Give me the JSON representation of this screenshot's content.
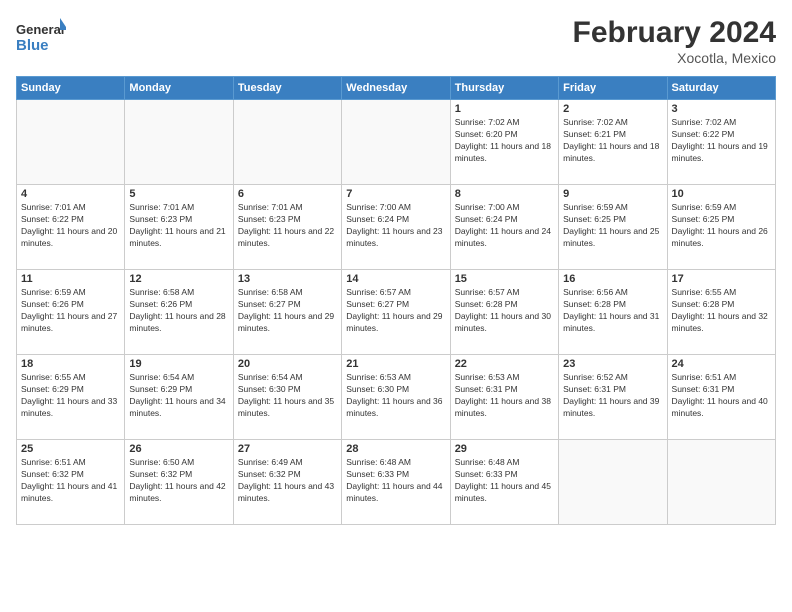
{
  "header": {
    "logo_general": "General",
    "logo_blue": "Blue",
    "main_title": "February 2024",
    "sub_title": "Xocotla, Mexico"
  },
  "weekdays": [
    "Sunday",
    "Monday",
    "Tuesday",
    "Wednesday",
    "Thursday",
    "Friday",
    "Saturday"
  ],
  "days": [
    {
      "num": "",
      "empty": true
    },
    {
      "num": "",
      "empty": true
    },
    {
      "num": "",
      "empty": true
    },
    {
      "num": "",
      "empty": true
    },
    {
      "num": "1",
      "sunrise": "7:02 AM",
      "sunset": "6:20 PM",
      "daylight": "11 hours and 18 minutes."
    },
    {
      "num": "2",
      "sunrise": "7:02 AM",
      "sunset": "6:21 PM",
      "daylight": "11 hours and 18 minutes."
    },
    {
      "num": "3",
      "sunrise": "7:02 AM",
      "sunset": "6:22 PM",
      "daylight": "11 hours and 19 minutes."
    },
    {
      "num": "4",
      "sunrise": "7:01 AM",
      "sunset": "6:22 PM",
      "daylight": "11 hours and 20 minutes."
    },
    {
      "num": "5",
      "sunrise": "7:01 AM",
      "sunset": "6:23 PM",
      "daylight": "11 hours and 21 minutes."
    },
    {
      "num": "6",
      "sunrise": "7:01 AM",
      "sunset": "6:23 PM",
      "daylight": "11 hours and 22 minutes."
    },
    {
      "num": "7",
      "sunrise": "7:00 AM",
      "sunset": "6:24 PM",
      "daylight": "11 hours and 23 minutes."
    },
    {
      "num": "8",
      "sunrise": "7:00 AM",
      "sunset": "6:24 PM",
      "daylight": "11 hours and 24 minutes."
    },
    {
      "num": "9",
      "sunrise": "6:59 AM",
      "sunset": "6:25 PM",
      "daylight": "11 hours and 25 minutes."
    },
    {
      "num": "10",
      "sunrise": "6:59 AM",
      "sunset": "6:25 PM",
      "daylight": "11 hours and 26 minutes."
    },
    {
      "num": "11",
      "sunrise": "6:59 AM",
      "sunset": "6:26 PM",
      "daylight": "11 hours and 27 minutes."
    },
    {
      "num": "12",
      "sunrise": "6:58 AM",
      "sunset": "6:26 PM",
      "daylight": "11 hours and 28 minutes."
    },
    {
      "num": "13",
      "sunrise": "6:58 AM",
      "sunset": "6:27 PM",
      "daylight": "11 hours and 29 minutes."
    },
    {
      "num": "14",
      "sunrise": "6:57 AM",
      "sunset": "6:27 PM",
      "daylight": "11 hours and 29 minutes."
    },
    {
      "num": "15",
      "sunrise": "6:57 AM",
      "sunset": "6:28 PM",
      "daylight": "11 hours and 30 minutes."
    },
    {
      "num": "16",
      "sunrise": "6:56 AM",
      "sunset": "6:28 PM",
      "daylight": "11 hours and 31 minutes."
    },
    {
      "num": "17",
      "sunrise": "6:55 AM",
      "sunset": "6:28 PM",
      "daylight": "11 hours and 32 minutes."
    },
    {
      "num": "18",
      "sunrise": "6:55 AM",
      "sunset": "6:29 PM",
      "daylight": "11 hours and 33 minutes."
    },
    {
      "num": "19",
      "sunrise": "6:54 AM",
      "sunset": "6:29 PM",
      "daylight": "11 hours and 34 minutes."
    },
    {
      "num": "20",
      "sunrise": "6:54 AM",
      "sunset": "6:30 PM",
      "daylight": "11 hours and 35 minutes."
    },
    {
      "num": "21",
      "sunrise": "6:53 AM",
      "sunset": "6:30 PM",
      "daylight": "11 hours and 36 minutes."
    },
    {
      "num": "22",
      "sunrise": "6:53 AM",
      "sunset": "6:31 PM",
      "daylight": "11 hours and 38 minutes."
    },
    {
      "num": "23",
      "sunrise": "6:52 AM",
      "sunset": "6:31 PM",
      "daylight": "11 hours and 39 minutes."
    },
    {
      "num": "24",
      "sunrise": "6:51 AM",
      "sunset": "6:31 PM",
      "daylight": "11 hours and 40 minutes."
    },
    {
      "num": "25",
      "sunrise": "6:51 AM",
      "sunset": "6:32 PM",
      "daylight": "11 hours and 41 minutes."
    },
    {
      "num": "26",
      "sunrise": "6:50 AM",
      "sunset": "6:32 PM",
      "daylight": "11 hours and 42 minutes."
    },
    {
      "num": "27",
      "sunrise": "6:49 AM",
      "sunset": "6:32 PM",
      "daylight": "11 hours and 43 minutes."
    },
    {
      "num": "28",
      "sunrise": "6:48 AM",
      "sunset": "6:33 PM",
      "daylight": "11 hours and 44 minutes."
    },
    {
      "num": "29",
      "sunrise": "6:48 AM",
      "sunset": "6:33 PM",
      "daylight": "11 hours and 45 minutes."
    },
    {
      "num": "",
      "empty": true
    },
    {
      "num": "",
      "empty": true
    }
  ],
  "labels": {
    "sunrise": "Sunrise:",
    "sunset": "Sunset:",
    "daylight": "Daylight:"
  }
}
